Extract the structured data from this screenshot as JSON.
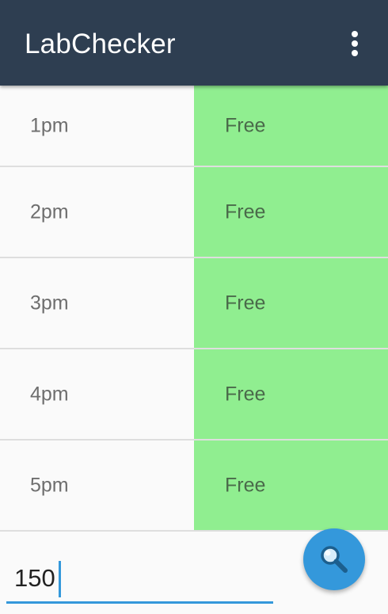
{
  "toolbar": {
    "title": "LabChecker",
    "background_color": "#2e3e51",
    "overflow_icon": "more-vert-icon"
  },
  "schedule": {
    "free_color": "#90ee90",
    "rows": [
      {
        "time": "1pm",
        "status": "Free"
      },
      {
        "time": "2pm",
        "status": "Free"
      },
      {
        "time": "3pm",
        "status": "Free"
      },
      {
        "time": "4pm",
        "status": "Free"
      },
      {
        "time": "5pm",
        "status": "Free"
      }
    ]
  },
  "search": {
    "input_value": "150",
    "accent_color": "#3498db",
    "button_icon": "search-icon"
  }
}
